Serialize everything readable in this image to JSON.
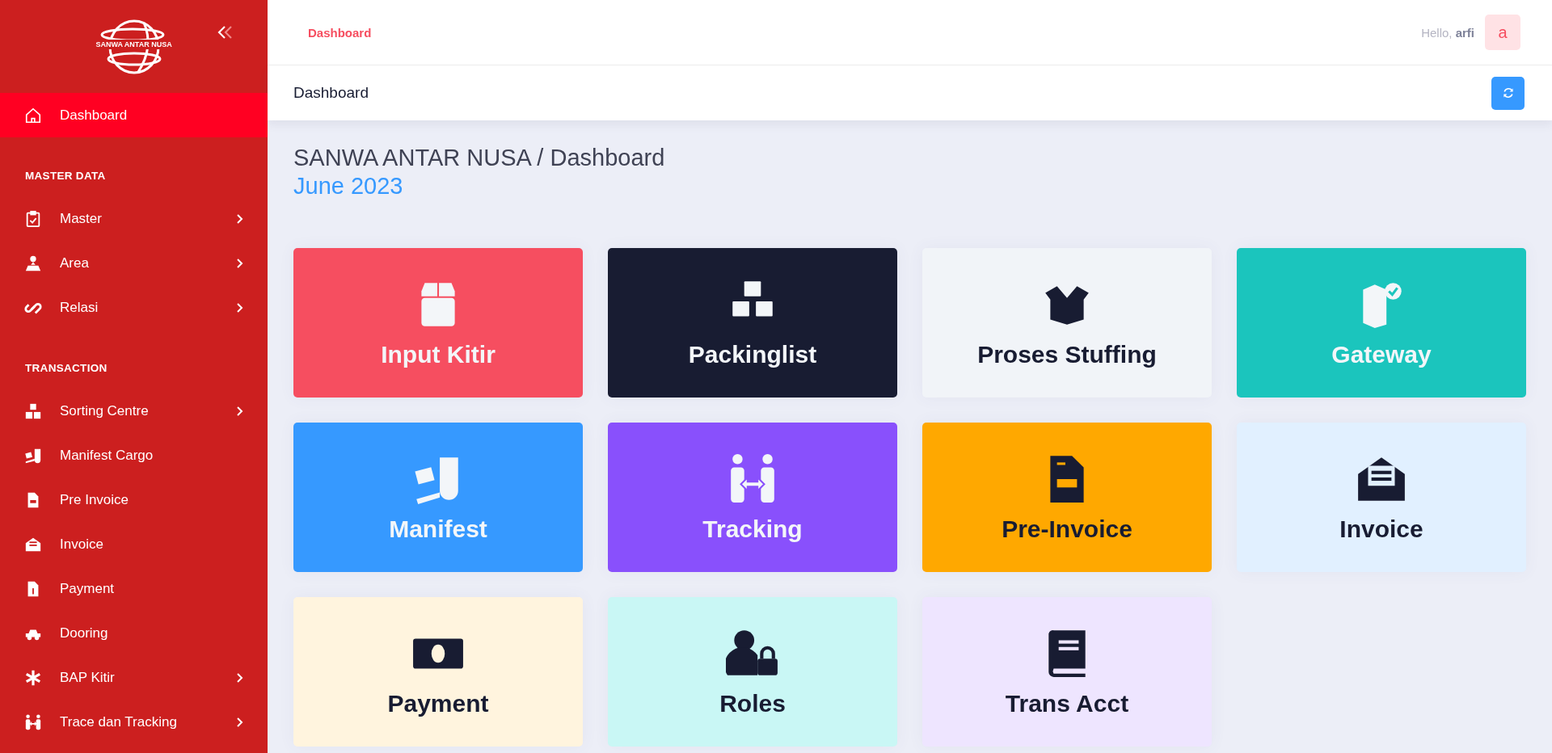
{
  "sidebar": {
    "logo_text": "SANWA ANTAR NUSA",
    "items": [
      {
        "kind": "item",
        "label": "Dashboard",
        "selected": true,
        "submenu": false
      },
      {
        "kind": "section",
        "label": "MASTER DATA"
      },
      {
        "kind": "item",
        "label": "Master",
        "selected": false,
        "submenu": true
      },
      {
        "kind": "item",
        "label": "Area",
        "selected": false,
        "submenu": true
      },
      {
        "kind": "item",
        "label": "Relasi",
        "selected": false,
        "submenu": true
      },
      {
        "kind": "section",
        "label": "TRANSACTION"
      },
      {
        "kind": "item",
        "label": "Sorting Centre",
        "selected": false,
        "submenu": true
      },
      {
        "kind": "item",
        "label": "Manifest Cargo",
        "selected": false,
        "submenu": false
      },
      {
        "kind": "item",
        "label": "Pre Invoice",
        "selected": false,
        "submenu": false
      },
      {
        "kind": "item",
        "label": "Invoice",
        "selected": false,
        "submenu": false
      },
      {
        "kind": "item",
        "label": "Payment",
        "selected": false,
        "submenu": false
      },
      {
        "kind": "item",
        "label": "Dooring",
        "selected": false,
        "submenu": false
      },
      {
        "kind": "item",
        "label": "BAP Kitir",
        "selected": false,
        "submenu": true
      },
      {
        "kind": "item",
        "label": "Trace dan Tracking",
        "selected": false,
        "submenu": true
      }
    ]
  },
  "topbar": {
    "active_link": "Dashboard",
    "greeting": "Hello,",
    "user": "arfi",
    "avatar": "a"
  },
  "subheader": {
    "title": "Dashboard"
  },
  "page": {
    "breadcrumb": "SANWA ANTAR NUSA / Dashboard",
    "period": "June 2023"
  },
  "cards": [
    {
      "label": "Input Kitir",
      "color": "#f64e60"
    },
    {
      "label": "Packinglist",
      "color": "#181c32"
    },
    {
      "label": "Proses Stuffing",
      "color": "#f1f4f8"
    },
    {
      "label": "Gateway",
      "color": "#1bc5bd"
    },
    {
      "label": "Manifest",
      "color": "#3699ff"
    },
    {
      "label": "Tracking",
      "color": "#8950fc"
    },
    {
      "label": "Pre-Invoice",
      "color": "#ffa800"
    },
    {
      "label": "Invoice",
      "color": "#e1f0ff"
    },
    {
      "label": "Payment",
      "color": "#fff4de"
    },
    {
      "label": "Roles",
      "color": "#c9f7f5"
    },
    {
      "label": "Trans Acct",
      "color": "#eee5ff"
    }
  ]
}
